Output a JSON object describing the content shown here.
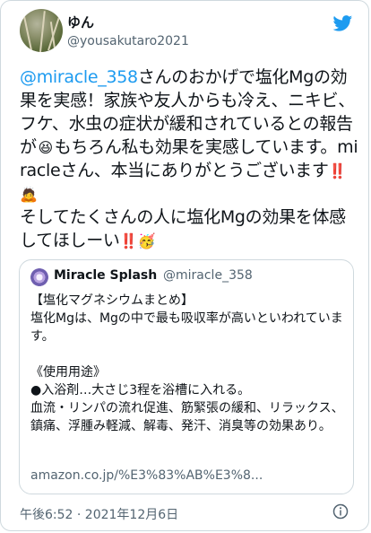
{
  "author": {
    "display_name": "ゆん",
    "handle": "@yousakutaro2021"
  },
  "tweet": {
    "mention": "@miracle_358",
    "text_1": "さんのおかげで塩化Mgの効果を実感！家族や友人からも冷え、ニキビ、フケ、水虫の症状が緩和されているとの報告が",
    "emoji_1": "😆",
    "text_2": "もちろん私も効果を実感しています。miracleさん、本当にありがとうございます",
    "emoji_2": "‼️",
    "emoji_3": "🙇",
    "text_3": "\nそしてたくさんの人に塩化Mgの効果を体感してほしーい",
    "emoji_4": "‼️",
    "emoji_5": "🥳"
  },
  "quote": {
    "display_name": "Miracle Splash",
    "handle": "@miracle_358",
    "text": "【塩化マグネシウムまとめ】\n塩化Mgは、Mgの中で最も吸収率が高いといわれています。\n\n《使用用途》\n●入浴剤…大さじ3程を浴槽に入れる。\n血流・リンパの流れ促進、筋緊張の緩和、リラックス、鎮痛、浮腫み軽減、解毒、発汗、消臭等の効果あり。",
    "link": "amazon.co.jp/%E3%83%AB%E3%8..."
  },
  "timestamp": "午後6:52 · 2021年12月6日",
  "icons": {
    "logo": "twitter-bird-icon",
    "info": "info-icon"
  },
  "colors": {
    "accent": "#1d9bf0",
    "muted": "#536471",
    "border": "#cfd9de"
  }
}
